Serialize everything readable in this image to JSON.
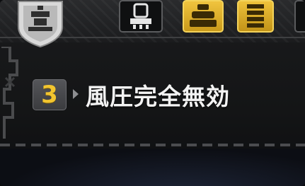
{
  "skill": {
    "level": "3",
    "name": "風圧完全無効"
  },
  "top_bar": {
    "slots": [
      {
        "icon": "crest-emblem-icon",
        "state": "emblem"
      },
      {
        "icon": "weapon-icon",
        "state": "inactive"
      },
      {
        "icon": "armor-piece-icon",
        "state": "active"
      },
      {
        "icon": "armor-piece-icon",
        "state": "active"
      },
      {
        "icon": "slot-icon",
        "state": "inactive"
      }
    ]
  },
  "colors": {
    "accent_gold": "#f2c52f",
    "text": "#f3f3f3",
    "panel_bg": "#141516"
  }
}
